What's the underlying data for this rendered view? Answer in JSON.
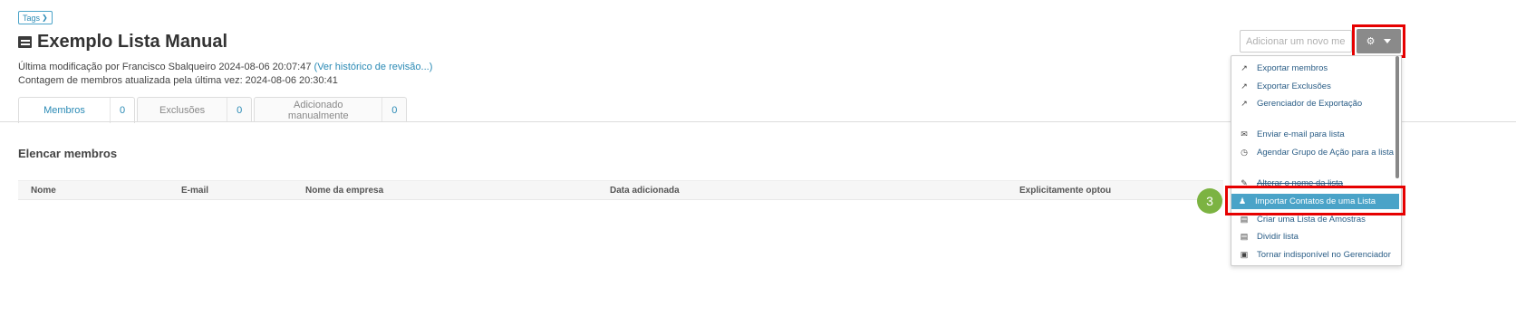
{
  "tags_button": {
    "label": "Tags"
  },
  "header": {
    "title": "Exemplo Lista Manual"
  },
  "meta": {
    "modified_text": "Última modificação por Francisco Sbalqueiro 2024-08-06 20:07:47",
    "history_link": "(Ver histórico de revisão...)",
    "count_text": "Contagem de membros atualizada pela última vez: 2024-08-06 20:30:41"
  },
  "tabs": [
    {
      "label": "Membros",
      "count": "0"
    },
    {
      "label": "Exclusões",
      "count": "0"
    },
    {
      "label": "Adicionado manualmente",
      "count": "0"
    }
  ],
  "section": {
    "title": "Elencar membros"
  },
  "table": {
    "columns": [
      "Nome",
      "E-mail",
      "Nome da empresa",
      "Data adicionada",
      "Explicitamente optou"
    ]
  },
  "add_member": {
    "placeholder": "Adicionar um novo membro"
  },
  "menu": {
    "items": [
      {
        "label": "Exportar membros",
        "icon": "export-icon"
      },
      {
        "label": "Exportar Exclusões",
        "icon": "export-icon"
      },
      {
        "label": "Gerenciador de Exportação",
        "icon": "export-icon"
      },
      {
        "label": "Enviar e-mail para lista",
        "icon": "envelope-icon"
      },
      {
        "label": "Agendar Grupo de Ação para a lista",
        "icon": "clock-icon"
      },
      {
        "label": "Alterar o nome da lista",
        "icon": "edit-icon"
      },
      {
        "label": "Importar Contatos de uma Lista",
        "icon": "users-icon"
      },
      {
        "label": "Criar uma Lista de Amostras",
        "icon": "list-icon"
      },
      {
        "label": "Dividir lista",
        "icon": "list-icon"
      },
      {
        "label": "Tornar indisponível no Gerenciador",
        "icon": "archive-icon"
      }
    ]
  },
  "step_badge": {
    "number": "3"
  },
  "colors": {
    "accent": "#4aa3c8",
    "highlight_box": "#e60000",
    "badge": "#7cb342",
    "link": "#2a8ab5"
  }
}
